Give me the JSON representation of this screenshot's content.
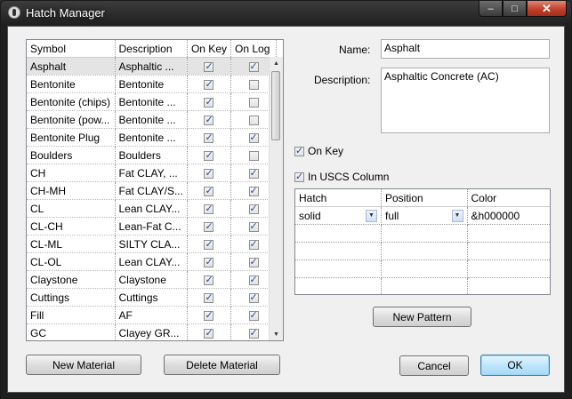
{
  "window": {
    "title": "Hatch Manager",
    "minimize": "–",
    "maximize": "□",
    "close": "✕"
  },
  "materials": {
    "columns": [
      "Symbol",
      "Description",
      "On Key",
      "On Log"
    ],
    "rows": [
      {
        "symbol": "Asphalt",
        "description": "Asphaltic ...",
        "on_key": true,
        "on_log": true
      },
      {
        "symbol": "Bentonite",
        "description": "Bentonite",
        "on_key": true,
        "on_log": false
      },
      {
        "symbol": "Bentonite (chips)",
        "description": "Bentonite ...",
        "on_key": true,
        "on_log": false
      },
      {
        "symbol": "Bentonite (pow...",
        "description": "Bentonite ...",
        "on_key": true,
        "on_log": false
      },
      {
        "symbol": "Bentonite Plug",
        "description": "Bentonite ...",
        "on_key": true,
        "on_log": true
      },
      {
        "symbol": "Boulders",
        "description": "Boulders",
        "on_key": true,
        "on_log": false
      },
      {
        "symbol": "CH",
        "description": "Fat CLAY, ...",
        "on_key": true,
        "on_log": true
      },
      {
        "symbol": "CH-MH",
        "description": "Fat CLAY/S...",
        "on_key": true,
        "on_log": true
      },
      {
        "symbol": "CL",
        "description": "Lean CLAY...",
        "on_key": true,
        "on_log": true
      },
      {
        "symbol": "CL-CH",
        "description": "Lean-Fat C...",
        "on_key": true,
        "on_log": true
      },
      {
        "symbol": "CL-ML",
        "description": "SILTY CLA...",
        "on_key": true,
        "on_log": true
      },
      {
        "symbol": "CL-OL",
        "description": "Lean CLAY...",
        "on_key": true,
        "on_log": true
      },
      {
        "symbol": "Claystone",
        "description": "Claystone",
        "on_key": true,
        "on_log": true
      },
      {
        "symbol": "Cuttings",
        "description": "Cuttings",
        "on_key": true,
        "on_log": true
      },
      {
        "symbol": "Fill",
        "description": "AF",
        "on_key": true,
        "on_log": true
      },
      {
        "symbol": "GC",
        "description": "Clayey GR...",
        "on_key": true,
        "on_log": true
      }
    ],
    "selected_index": 0
  },
  "buttons": {
    "new_material": "New Material",
    "delete_material": "Delete Material",
    "new_pattern": "New Pattern",
    "cancel": "Cancel",
    "ok": "OK"
  },
  "detail": {
    "name_label": "Name:",
    "name_value": "Asphalt",
    "description_label": "Description:",
    "description_value": "Asphaltic Concrete (AC)",
    "on_key_label": "On Key",
    "on_key_checked": true,
    "in_uscs_label": "In USCS Column",
    "in_uscs_checked": true
  },
  "hatch": {
    "columns": [
      "Hatch",
      "Position",
      "Color"
    ],
    "rows": [
      {
        "hatch": "solid",
        "position": "full",
        "color": "&h000000"
      }
    ],
    "empty_rows": 4
  }
}
